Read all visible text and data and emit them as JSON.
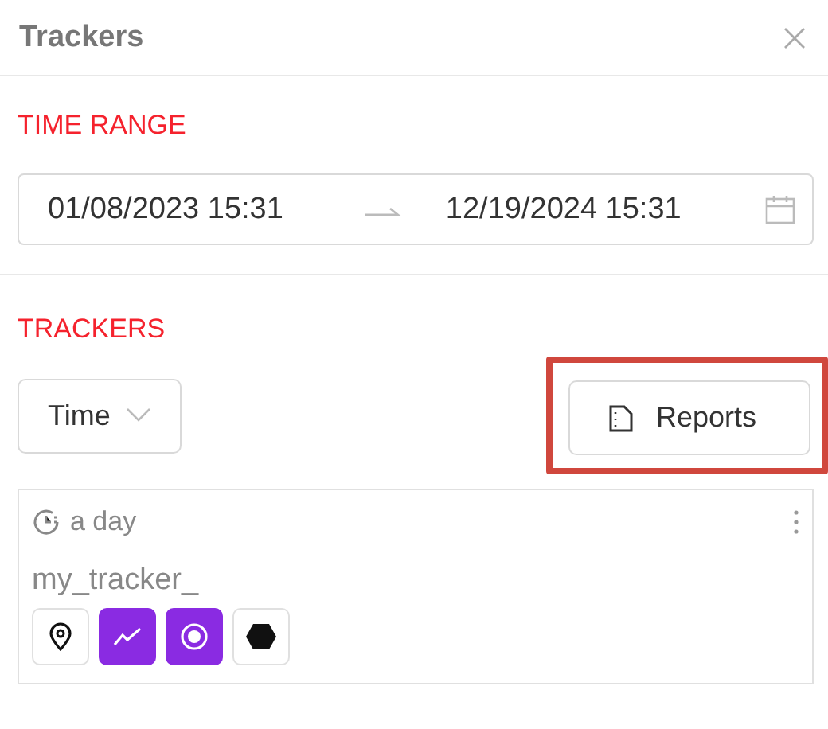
{
  "panel": {
    "title": "Trackers"
  },
  "time_range": {
    "heading": "TIME RANGE",
    "start": "01/08/2023 15:31",
    "end": "12/19/2024 15:31"
  },
  "trackers": {
    "heading": "TRACKERS",
    "sort_select": {
      "value": "Time"
    },
    "reports_button": {
      "label": "Reports",
      "highlighted": true
    },
    "items": [
      {
        "interval": "a day",
        "name": "my_tracker_",
        "toggles": [
          {
            "kind": "pin",
            "on": false
          },
          {
            "kind": "trend",
            "on": true
          },
          {
            "kind": "target",
            "on": true
          },
          {
            "kind": "hexagon",
            "on": false
          }
        ]
      }
    ]
  }
}
